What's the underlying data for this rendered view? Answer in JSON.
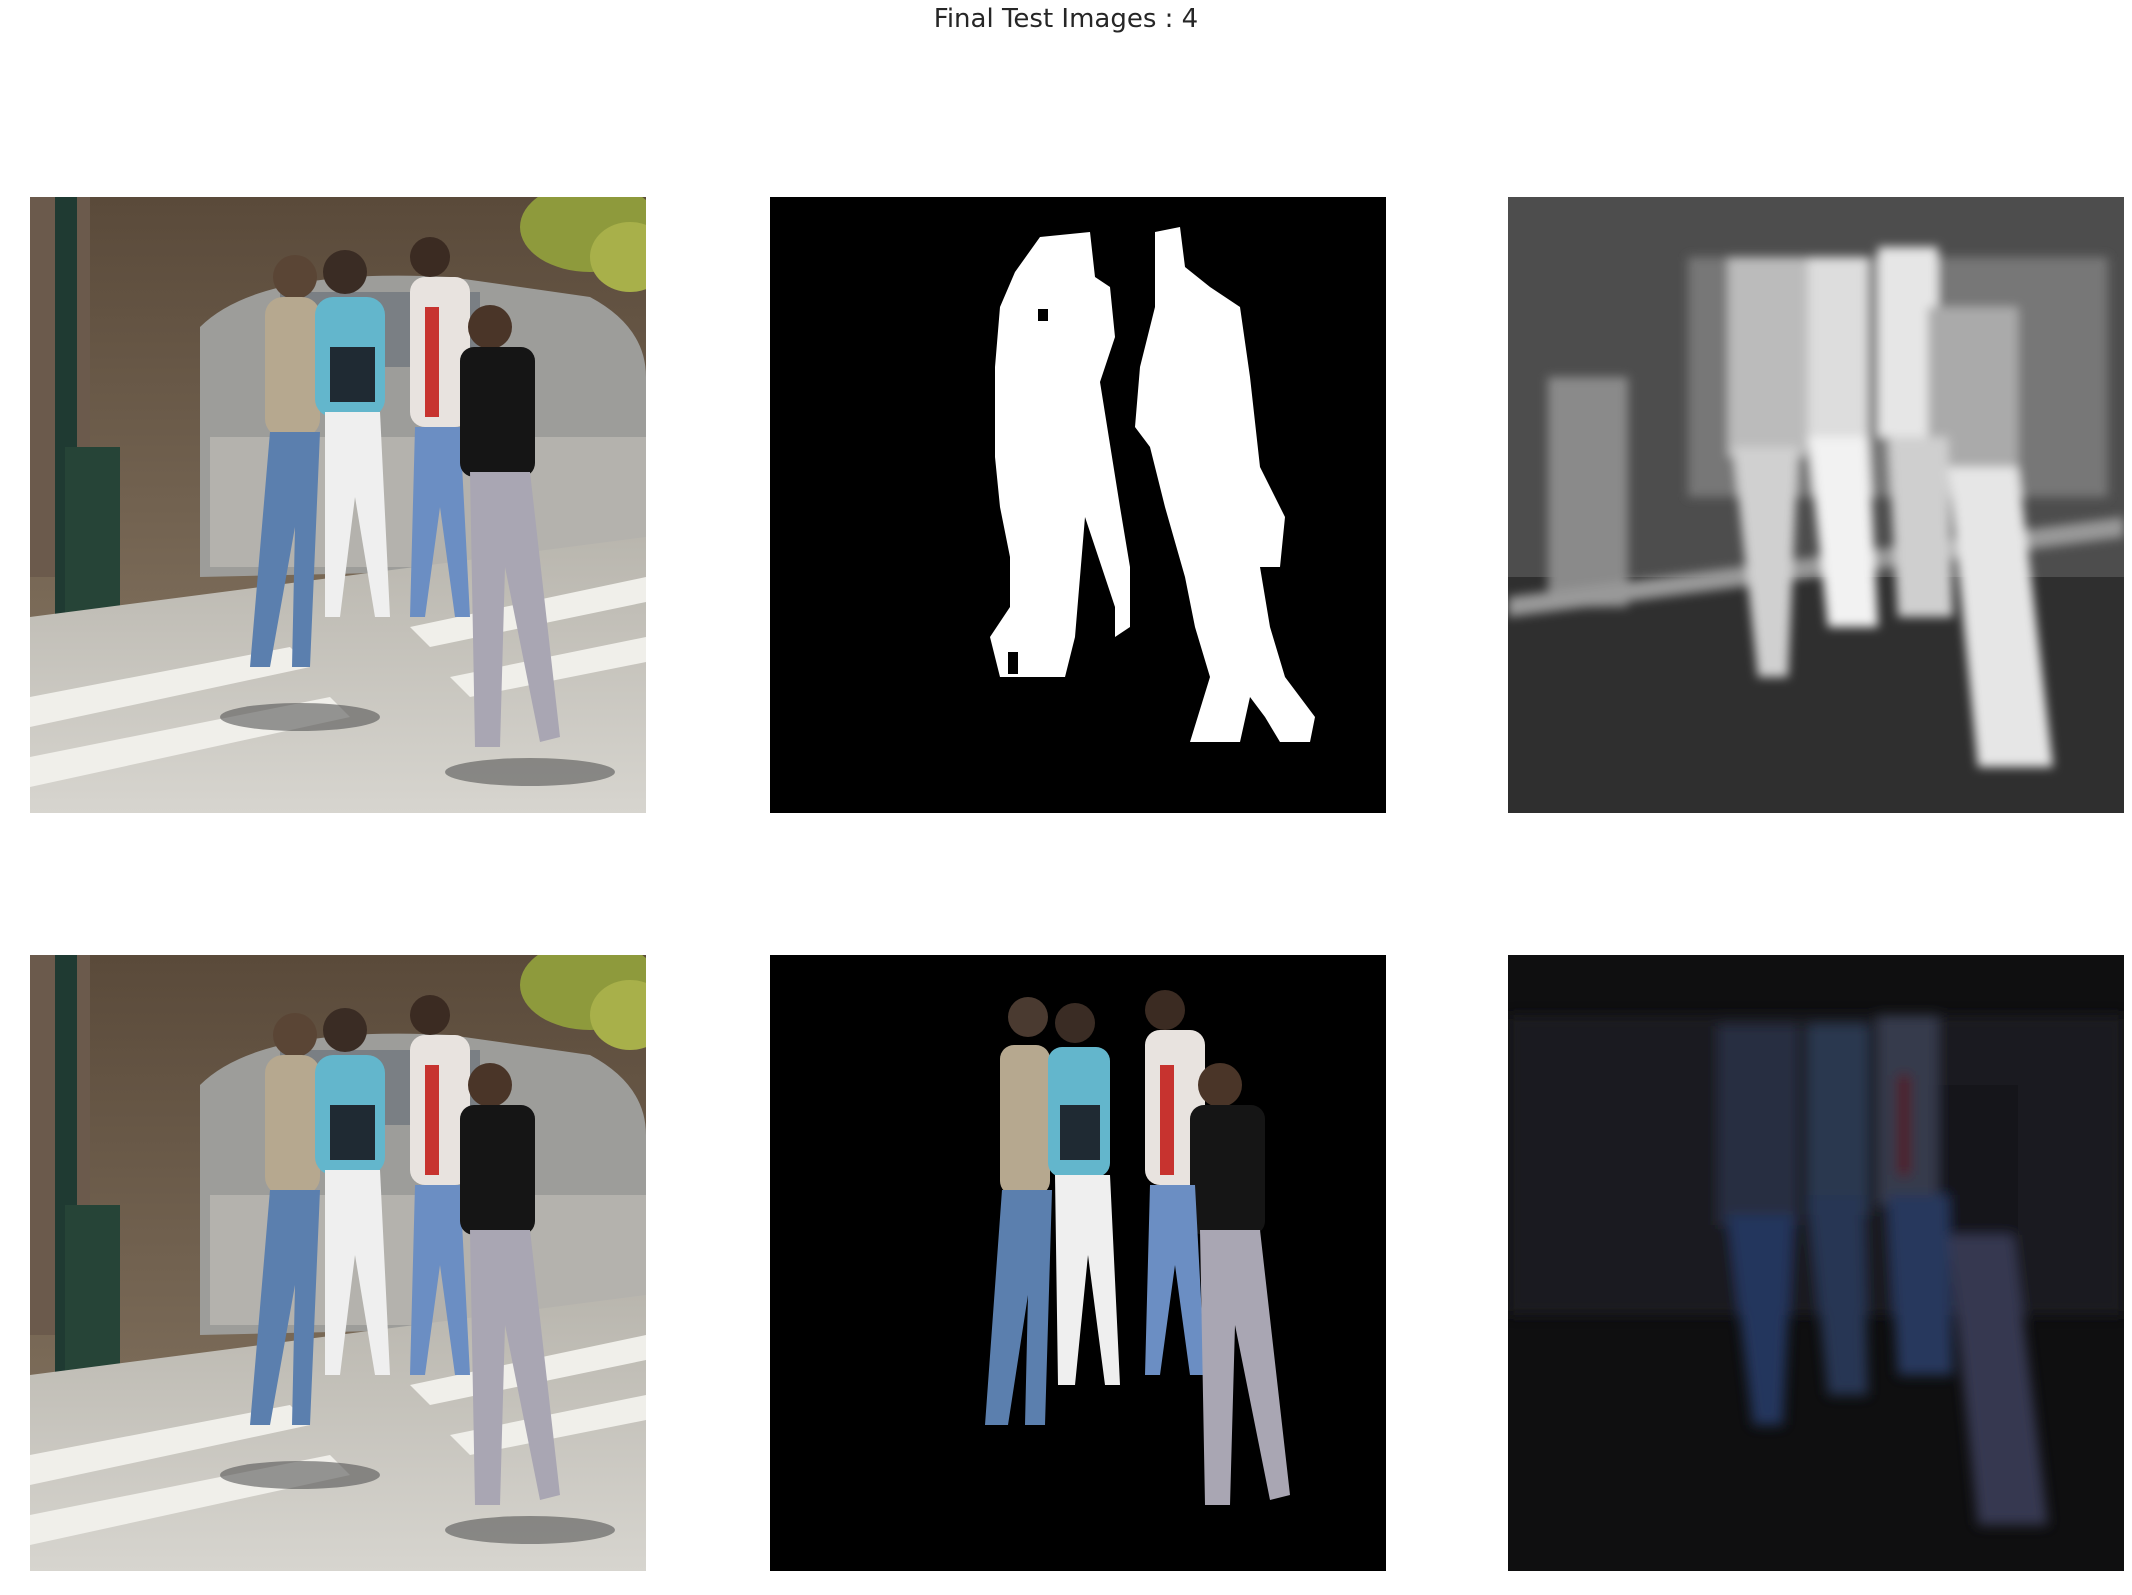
{
  "figure": {
    "suptitle": "Final Test Images : 4",
    "rows": [
      {
        "panels": [
          {
            "content": "input photograph: four people walking on a street crosswalk",
            "style": "color"
          },
          {
            "content": "ground-truth segmentation mask: white person silhouettes on black",
            "style": "binary-mask"
          },
          {
            "content": "predicted saliency/probability map in grayscale",
            "style": "grayscale"
          }
        ]
      },
      {
        "panels": [
          {
            "content": "input photograph: four people walking on a street crosswalk",
            "style": "color"
          },
          {
            "content": "masked image: people kept in color, background black",
            "style": "masked-color"
          },
          {
            "content": "predicted output overlaid on dark image",
            "style": "dark-color"
          }
        ]
      }
    ]
  },
  "colors": {
    "background": "#ffffff",
    "title_text": "#262626",
    "mask_fg": "#ffffff",
    "mask_bg": "#000000"
  }
}
